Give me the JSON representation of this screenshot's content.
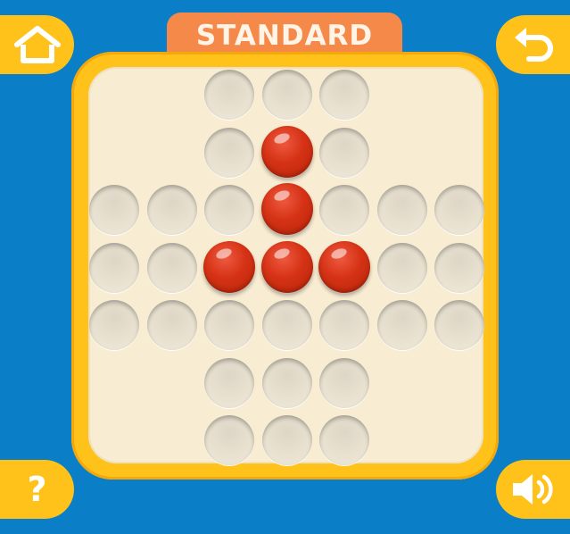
{
  "game": {
    "mode_label": "STANDARD",
    "board_type": "english-cross peg solitaire",
    "rows": 7,
    "cols": 7,
    "cells": [
      [
        null,
        null,
        "hole",
        "hole",
        "hole",
        null,
        null
      ],
      [
        null,
        null,
        "hole",
        "peg",
        "hole",
        null,
        null
      ],
      [
        "hole",
        "hole",
        "hole",
        "peg",
        "hole",
        "hole",
        "hole"
      ],
      [
        "hole",
        "hole",
        "peg",
        "peg",
        "peg",
        "hole",
        "hole"
      ],
      [
        "hole",
        "hole",
        "hole",
        "hole",
        "hole",
        "hole",
        "hole"
      ],
      [
        null,
        null,
        "hole",
        "hole",
        "hole",
        null,
        null
      ],
      [
        null,
        null,
        "hole",
        "hole",
        "hole",
        null,
        null
      ]
    ]
  },
  "controls": {
    "home_icon": "house-icon",
    "undo_icon": "undo-arrow-icon",
    "help_icon": "question-mark-icon",
    "help_glyph": "?",
    "sound_icon": "speaker-icon"
  },
  "colors": {
    "background": "#0a7fc7",
    "button": "#ffc21a",
    "tab": "#f4894a",
    "board_frame": "#ffc21a",
    "board_surface": "#f8edd2",
    "peg": "#d53215"
  }
}
